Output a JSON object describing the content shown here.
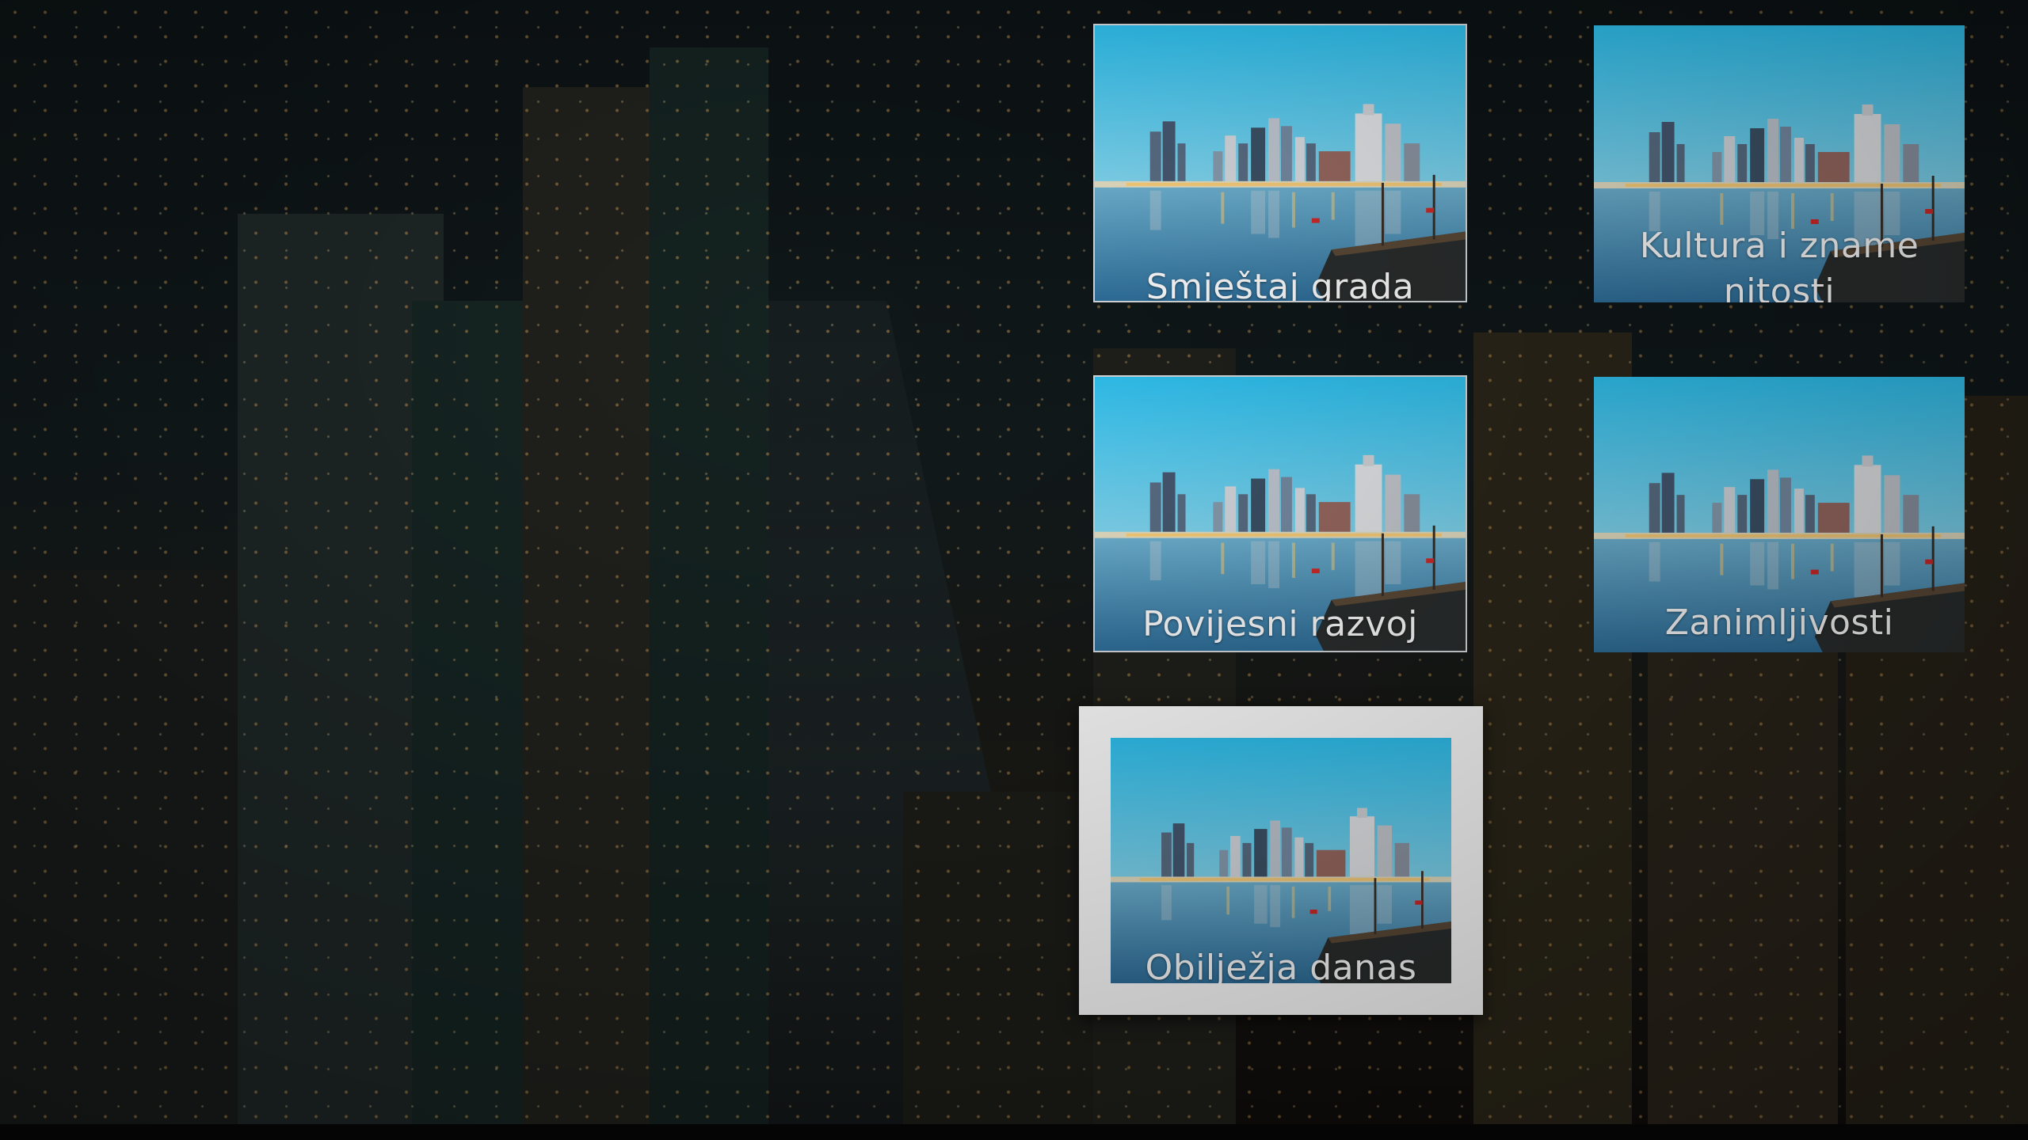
{
  "slide": {
    "tiles": [
      {
        "label": "Smještaj grada"
      },
      {
        "label": "Kultura i zname nitosti"
      },
      {
        "label": "Povijesni razvoj"
      },
      {
        "label": "Zanimljivosti"
      },
      {
        "label": "Obilježja danas"
      }
    ]
  },
  "colors": {
    "sky_top": "#3fc6f0",
    "sky_bottom": "#8fdcf2",
    "water": "#3f7da8",
    "frame": "#ffffff"
  }
}
